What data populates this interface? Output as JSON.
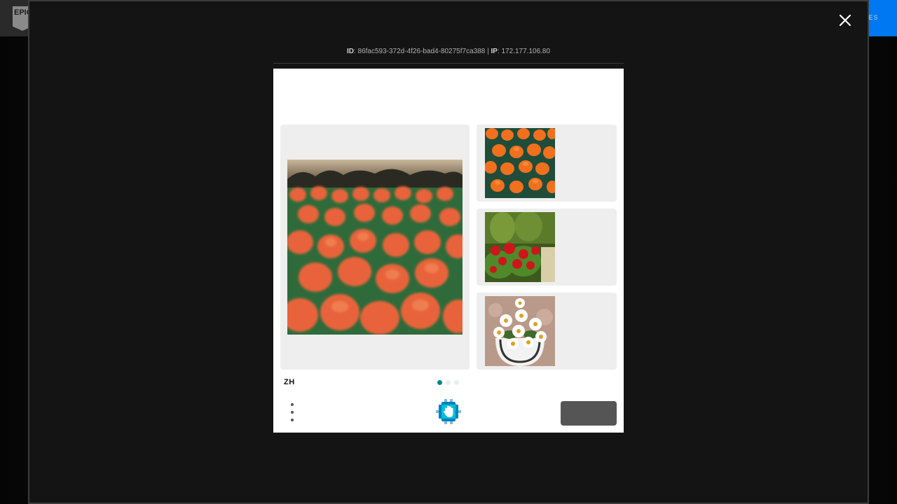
{
  "background": {
    "logo_text": "EPIC",
    "cta_text": "IES"
  },
  "session": {
    "id_label": "ID",
    "id_value": "86fac593-372d-4f26-bad4-80275f7ca388",
    "separator": "|",
    "ip_label": "IP",
    "ip_value": "172.177.106.80"
  },
  "captcha": {
    "title": "",
    "choices": [
      {
        "label": "",
        "icon": "tulip-field-thumbnail"
      },
      {
        "label": "",
        "icon": "red-flowers-hedge-thumbnail"
      },
      {
        "label": "",
        "icon": "daisies-vase-thumbnail"
      }
    ],
    "language": "ZH",
    "page_dots": 3,
    "active_dot": 0,
    "submit_label": ""
  },
  "colors": {
    "accent": "#00838f",
    "submit_bg": "#555555",
    "panel_bg": "#eeeeee"
  }
}
